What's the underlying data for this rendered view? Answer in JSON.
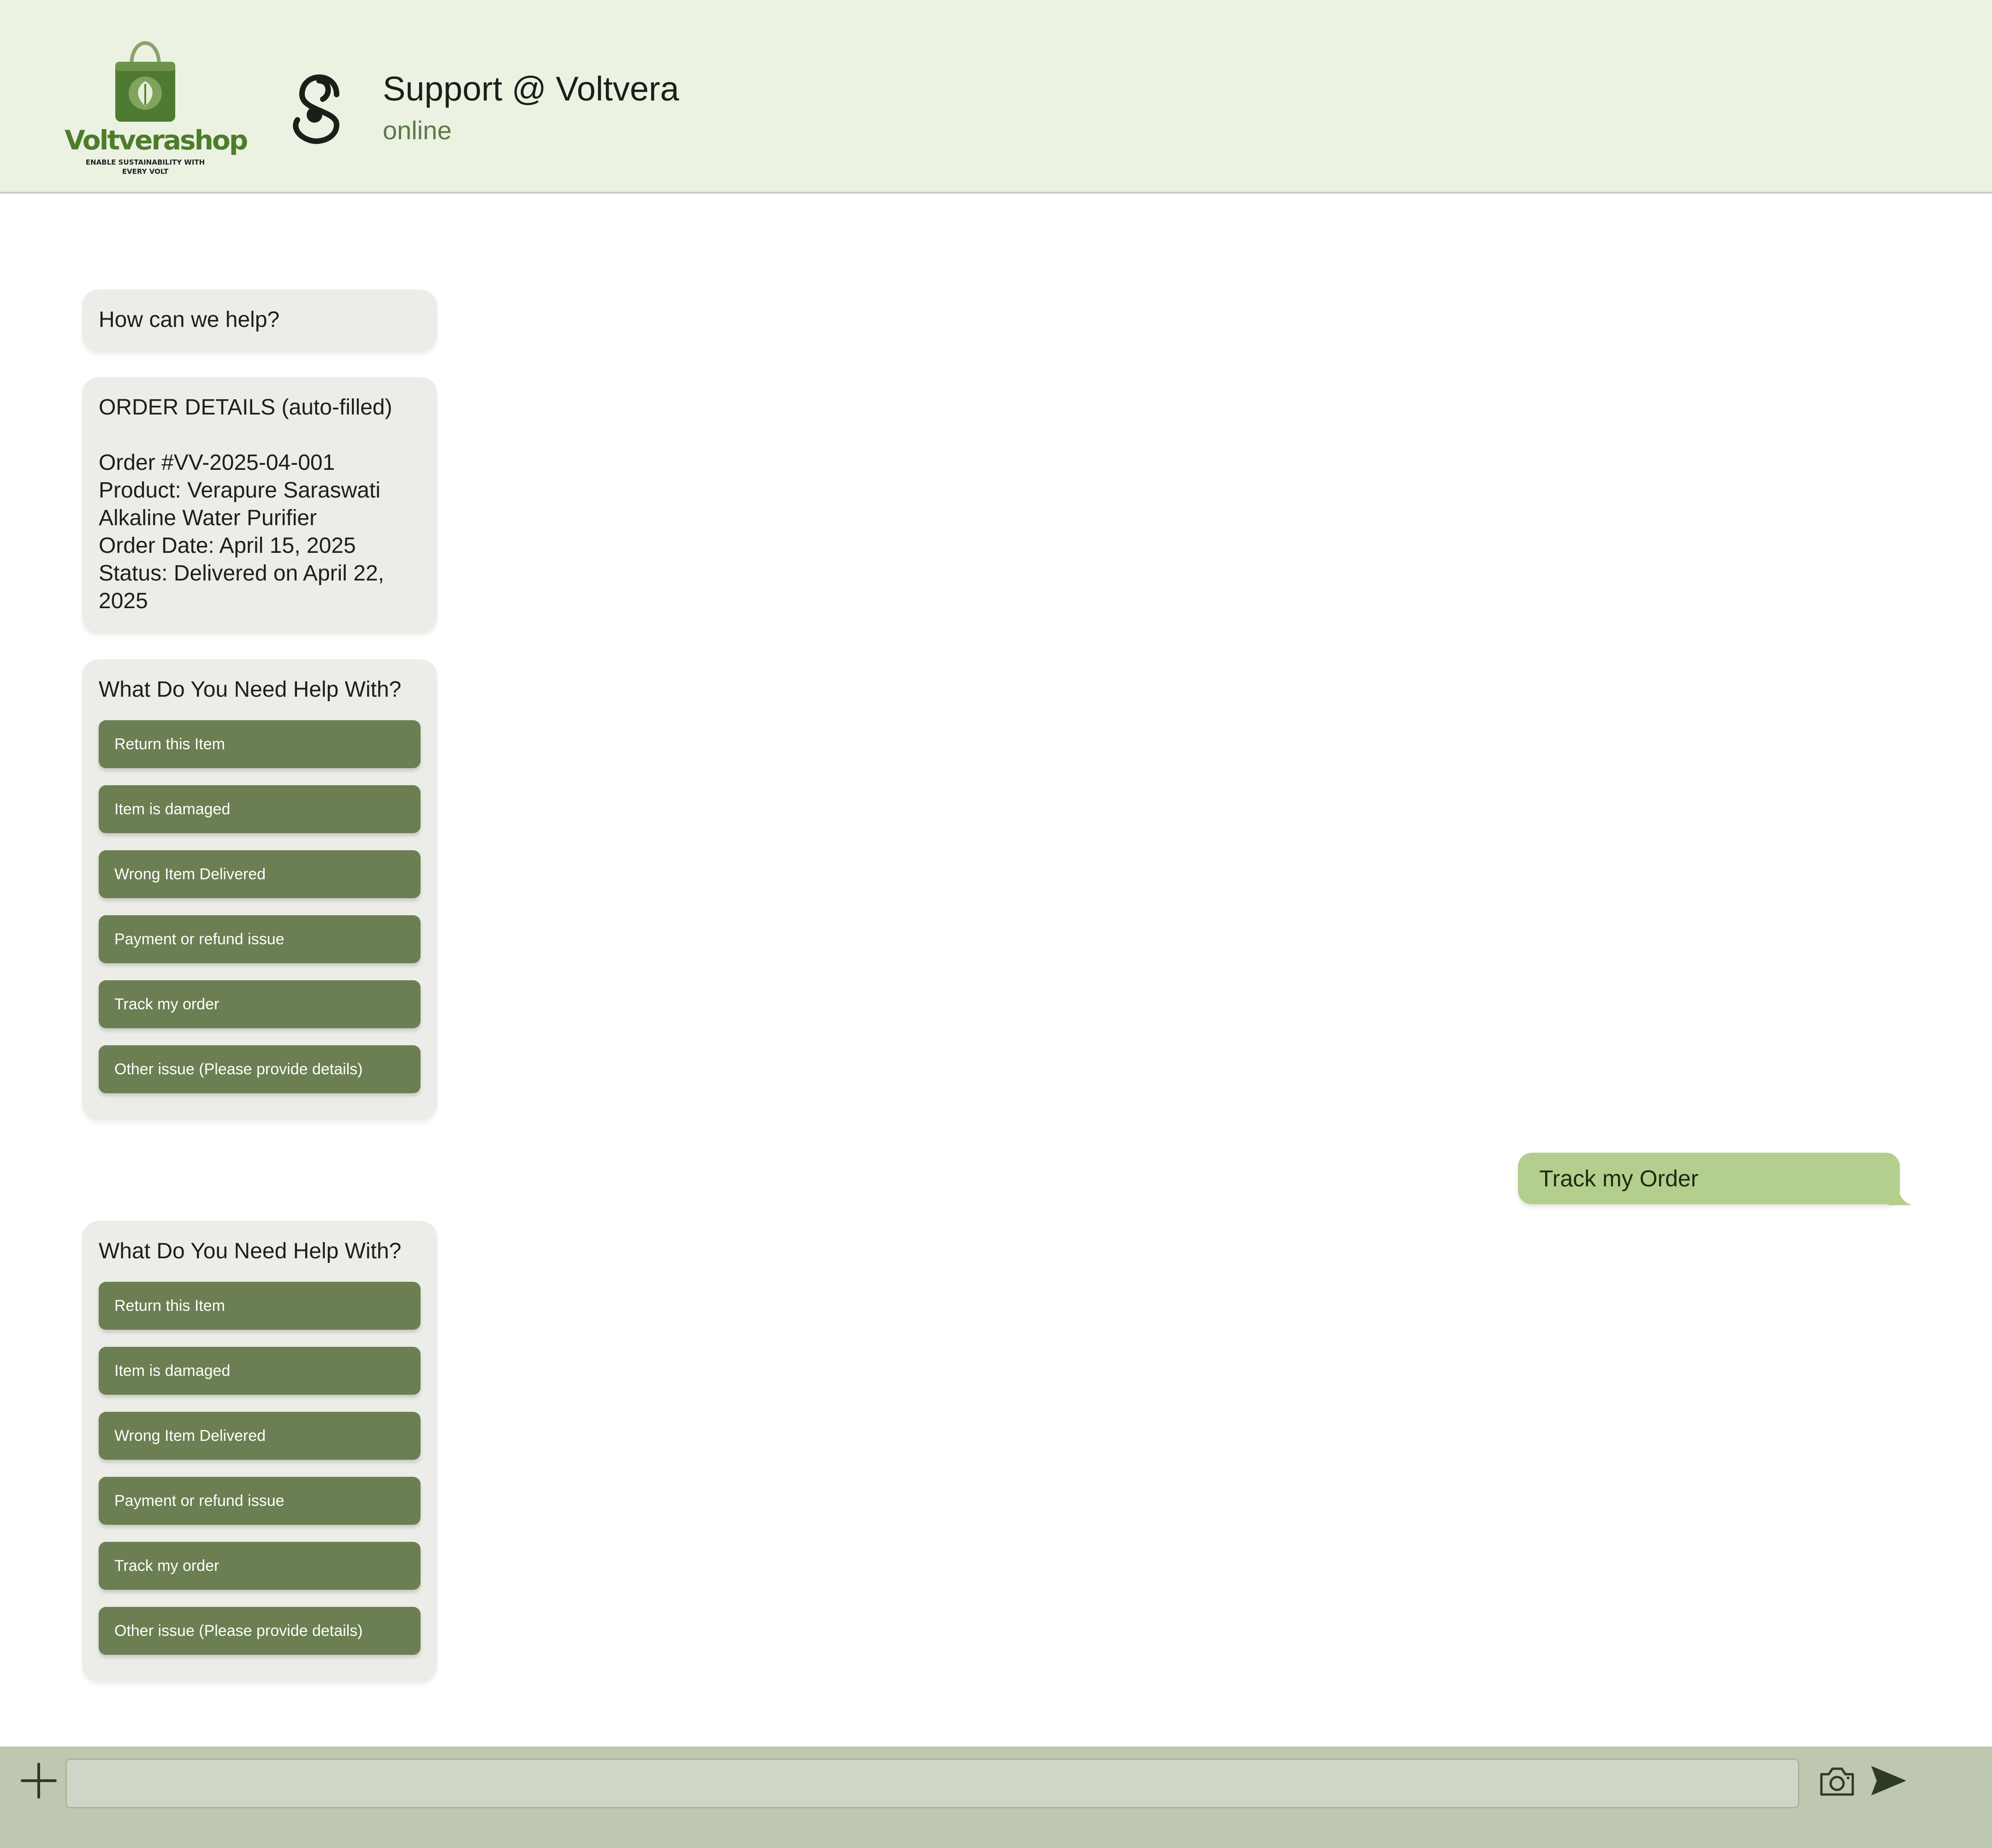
{
  "colors": {
    "header_bg": "#ebf2e2",
    "brand_green": "#4d7d2b",
    "option_button": "#6b7f52",
    "user_bubble": "#b4cf8d",
    "bot_bubble": "#ecede8",
    "composer_bg": "#bec8b1"
  },
  "header": {
    "logo": {
      "wordmark": "Voltverashop",
      "tagline": "ENABLE SUSTAINABILITY WITH EVERY VOLT",
      "icon": "shopping-bag-leaf-icon"
    },
    "agent_icon": "support-agent-icon",
    "title": "Support @ Voltvera",
    "status": "online"
  },
  "messages": {
    "greeting": "How can we help?",
    "order_details": {
      "heading": "ORDER DETAILS (auto-filled)",
      "lines": [
        "Order #VV-2025-04-001",
        "Product: Verapure Saraswati",
        "Alkaline Water Purifier",
        "Order Date: April 15, 2025",
        "Status: Delivered on April 22,",
        "2025"
      ]
    },
    "menus": [
      {
        "title": "What Do You Need Help With?",
        "options": [
          "Return this Item",
          "Item is damaged",
          "Wrong Item Delivered",
          "Payment or refund issue",
          "Track my order",
          "Other issue (Please provide details)"
        ]
      },
      {
        "title": "What Do You Need Help With?",
        "options": [
          "Return this Item",
          "Item is damaged",
          "Wrong Item Delivered",
          "Payment or refund issue",
          "Track my order",
          "Other issue (Please provide details)"
        ]
      }
    ],
    "user_reply": "Track my Order"
  },
  "composer": {
    "value": "",
    "placeholder": "",
    "icons": {
      "attach": "plus-icon",
      "camera": "camera-icon",
      "send": "send-icon"
    }
  }
}
